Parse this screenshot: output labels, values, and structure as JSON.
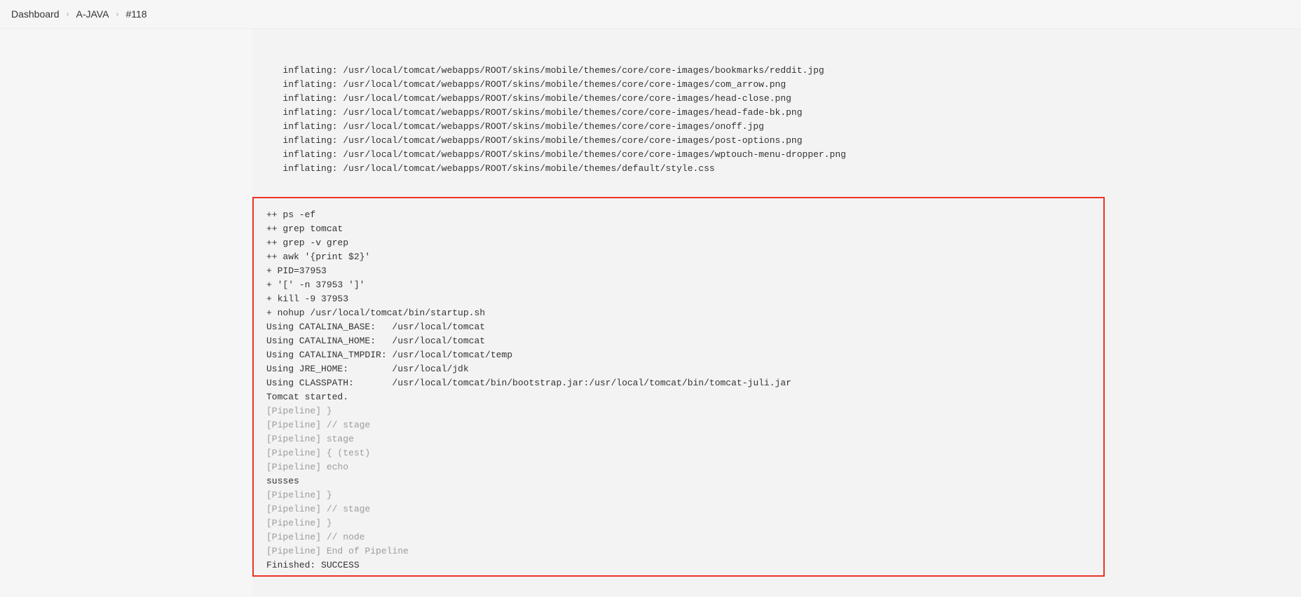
{
  "breadcrumb": {
    "items": [
      {
        "label": "Dashboard"
      },
      {
        "label": "A-JAVA"
      },
      {
        "label": "#118"
      }
    ],
    "sep": "›"
  },
  "console": {
    "top_lines": [
      "   inflating: /usr/local/tomcat/webapps/ROOT/skins/mobile/themes/core/core-images/bookmarks/reddit.jpg  ",
      "   inflating: /usr/local/tomcat/webapps/ROOT/skins/mobile/themes/core/core-images/com_arrow.png  ",
      "   inflating: /usr/local/tomcat/webapps/ROOT/skins/mobile/themes/core/core-images/head-close.png  ",
      "   inflating: /usr/local/tomcat/webapps/ROOT/skins/mobile/themes/core/core-images/head-fade-bk.png  ",
      "   inflating: /usr/local/tomcat/webapps/ROOT/skins/mobile/themes/core/core-images/onoff.jpg  ",
      "   inflating: /usr/local/tomcat/webapps/ROOT/skins/mobile/themes/core/core-images/post-options.png  ",
      "   inflating: /usr/local/tomcat/webapps/ROOT/skins/mobile/themes/core/core-images/wptouch-menu-dropper.png  ",
      "   inflating: /usr/local/tomcat/webapps/ROOT/skins/mobile/themes/default/style.css  "
    ],
    "hl_lines": [
      {
        "t": "++ ps -ef",
        "dim": false
      },
      {
        "t": "++ grep tomcat",
        "dim": false
      },
      {
        "t": "++ grep -v grep",
        "dim": false
      },
      {
        "t": "++ awk '{print $2}'",
        "dim": false
      },
      {
        "t": "+ PID=37953",
        "dim": false
      },
      {
        "t": "+ '[' -n 37953 ']'",
        "dim": false
      },
      {
        "t": "+ kill -9 37953",
        "dim": false
      },
      {
        "t": "+ nohup /usr/local/tomcat/bin/startup.sh",
        "dim": false
      },
      {
        "t": "Using CATALINA_BASE:   /usr/local/tomcat",
        "dim": false
      },
      {
        "t": "Using CATALINA_HOME:   /usr/local/tomcat",
        "dim": false
      },
      {
        "t": "Using CATALINA_TMPDIR: /usr/local/tomcat/temp",
        "dim": false
      },
      {
        "t": "Using JRE_HOME:        /usr/local/jdk",
        "dim": false
      },
      {
        "t": "Using CLASSPATH:       /usr/local/tomcat/bin/bootstrap.jar:/usr/local/tomcat/bin/tomcat-juli.jar",
        "dim": false
      },
      {
        "t": "Tomcat started.",
        "dim": false
      },
      {
        "t": "[Pipeline] }",
        "dim": true
      },
      {
        "t": "[Pipeline] // stage",
        "dim": true
      },
      {
        "t": "[Pipeline] stage",
        "dim": true
      },
      {
        "t": "[Pipeline] { (test)",
        "dim": true
      },
      {
        "t": "[Pipeline] echo",
        "dim": true
      },
      {
        "t": "susses",
        "dim": false
      },
      {
        "t": "[Pipeline] }",
        "dim": true
      },
      {
        "t": "[Pipeline] // stage",
        "dim": true
      },
      {
        "t": "[Pipeline] }",
        "dim": true
      },
      {
        "t": "[Pipeline] // node",
        "dim": true
      },
      {
        "t": "[Pipeline] End of Pipeline",
        "dim": true
      },
      {
        "t": "Finished: SUCCESS",
        "dim": false
      }
    ]
  }
}
